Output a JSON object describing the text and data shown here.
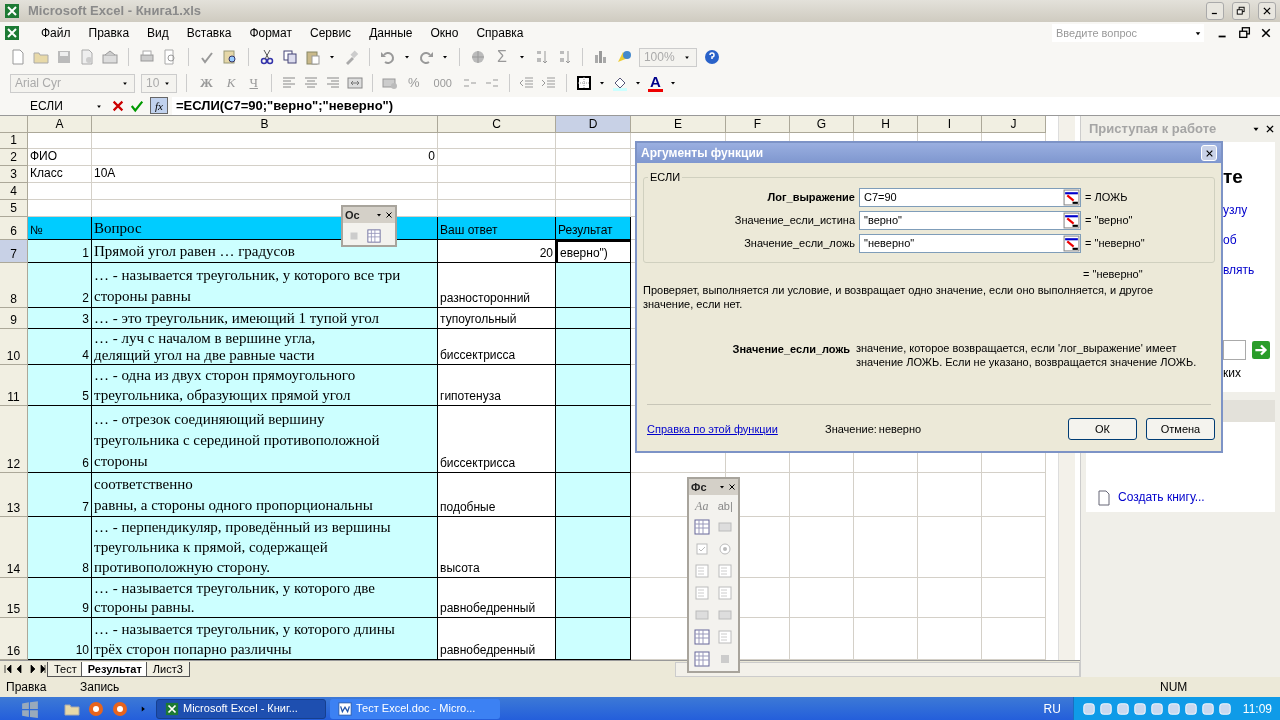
{
  "window": {
    "title": "Microsoft Excel - Книга1.xls"
  },
  "menu": [
    "Файл",
    "Правка",
    "Вид",
    "Вставка",
    "Формат",
    "Сервис",
    "Данные",
    "Окно",
    "Справка"
  ],
  "help_search": {
    "placeholder": "Введите вопрос"
  },
  "standard_toolbar": {
    "autosum": "Σ",
    "zoom": "100%"
  },
  "formatting_toolbar": {
    "font": "Arial Cyr",
    "size": "10",
    "bold": "Ж",
    "italic": "К",
    "underline": "Ч",
    "percent": "%",
    "thousands": "000",
    "font_color": "A"
  },
  "formula_bar": {
    "name_box": "ЕСЛИ",
    "fx": "fx",
    "formula": "=ЕСЛИ(C7=90;\"верно\";\"неверно\")"
  },
  "columns": [
    {
      "label": "A",
      "selected": false
    },
    {
      "label": "B",
      "selected": false
    },
    {
      "label": "C",
      "selected": false
    },
    {
      "label": "D",
      "selected": true
    },
    {
      "label": "E",
      "selected": false
    },
    {
      "label": "F",
      "selected": false
    },
    {
      "label": "G",
      "selected": false
    },
    {
      "label": "H",
      "selected": false
    },
    {
      "label": "I",
      "selected": false
    },
    {
      "label": "J",
      "selected": false
    }
  ],
  "rows": [
    {
      "header": "1",
      "selected": false
    },
    {
      "header": "2",
      "selected": false,
      "cells": [
        {
          "text": "ФИО",
          "kind": "text"
        },
        {
          "text": "0",
          "kind": "number"
        }
      ]
    },
    {
      "header": "3",
      "selected": false,
      "cells": [
        {
          "text": "Класс",
          "kind": "text"
        },
        {
          "text": "10А",
          "kind": "text"
        }
      ]
    },
    {
      "header": "4",
      "selected": false
    },
    {
      "header": "5",
      "selected": false
    },
    {
      "header": "6",
      "selected": false,
      "kind": "header",
      "cells": [
        {
          "text": "№",
          "kind": "text"
        },
        {
          "text": "Вопрос",
          "kind": "text"
        },
        {
          "text": "Ваш ответ",
          "kind": "text"
        },
        {
          "text": "Результат",
          "kind": "text"
        }
      ]
    },
    {
      "header": "7",
      "selected": true,
      "kind": "question",
      "cells": [
        {
          "text": "1",
          "kind": "number"
        },
        {
          "text": "Прямой угол равен … градусов",
          "kind": "text"
        },
        {
          "text": "20",
          "kind": "number"
        },
        {
          "text": "еверно\")",
          "kind": "edit"
        }
      ]
    },
    {
      "header": "8",
      "selected": false,
      "kind": "question",
      "cells": [
        {
          "text": "2",
          "kind": "number"
        },
        {
          "text": "… - называется треугольник, у которого все три\nстороны равны",
          "kind": "text"
        },
        {
          "text": "разносторонний",
          "kind": "text"
        }
      ]
    },
    {
      "header": "9",
      "selected": false,
      "kind": "question",
      "cells": [
        {
          "text": "3",
          "kind": "number"
        },
        {
          "text": "… - это треугольник, имеющий 1 тупой угол",
          "kind": "text"
        },
        {
          "text": "тупоугольный",
          "kind": "text"
        }
      ]
    },
    {
      "header": "10",
      "selected": false,
      "kind": "question",
      "cells": [
        {
          "text": "4",
          "kind": "number"
        },
        {
          "text": "… - луч с началом в вершине угла,\nделящий угол на две равные части",
          "kind": "text"
        },
        {
          "text": "биссектрисса",
          "kind": "text"
        }
      ]
    },
    {
      "header": "11",
      "selected": false,
      "kind": "question",
      "cells": [
        {
          "text": "5",
          "kind": "number"
        },
        {
          "text": "… - одна из двух сторон прямоугольного\nтреугольника, образующих прямой угол",
          "kind": "text"
        },
        {
          "text": "гипотенуза",
          "kind": "text"
        }
      ]
    },
    {
      "header": "12",
      "selected": false,
      "kind": "question",
      "cells": [
        {
          "text": "6",
          "kind": "number"
        },
        {
          "text": "… - отрезок соединяющий вершину\nтреугольника с серединой противоположной\nстороны",
          "kind": "text"
        },
        {
          "text": "биссектрисса",
          "kind": "text"
        }
      ]
    },
    {
      "header": "13",
      "selected": false,
      "kind": "question",
      "cells": [
        {
          "text": "7",
          "kind": "number"
        },
        {
          "text": "соответственно\nравны, а стороны одного пропорциональны",
          "kind": "text"
        },
        {
          "text": "подобные",
          "kind": "text"
        }
      ]
    },
    {
      "header": "14",
      "selected": false,
      "kind": "question",
      "cells": [
        {
          "text": "8",
          "kind": "number"
        },
        {
          "text": "… - перпендикуляр, проведённый из вершины\nтреугольника к прямой, содержащей\nпротивоположную сторону.",
          "kind": "text"
        },
        {
          "text": "высота",
          "kind": "text"
        }
      ]
    },
    {
      "header": "15",
      "selected": false,
      "kind": "question",
      "cells": [
        {
          "text": "9",
          "kind": "number"
        },
        {
          "text": "… - называется треугольник, у которого две\nстороны равны.",
          "kind": "text"
        },
        {
          "text": "равнобедренный",
          "kind": "text"
        }
      ]
    },
    {
      "header": "16",
      "selected": false,
      "kind": "question",
      "cells": [
        {
          "text": "10",
          "kind": "number"
        },
        {
          "text": "… - называется треугольник, у которого длины\nтрёх сторон попарно различны",
          "kind": "text"
        },
        {
          "text": "равнобедренный",
          "kind": "text"
        }
      ]
    }
  ],
  "outline_toolbar": {
    "title": "Ос"
  },
  "forms_toolbar": {
    "title": "Фс",
    "label_tool": "Aa",
    "edit_tool": "ab|"
  },
  "sheet_tabs": [
    {
      "label": "Тест",
      "selected": false
    },
    {
      "label": "Результат",
      "selected": true
    },
    {
      "label": "Лист3",
      "selected": false
    }
  ],
  "status_bar": {
    "mode": "Правка",
    "macro": "Запись",
    "num": "NUM"
  },
  "task_pane": {
    "title": "Приступая к работе",
    "heading_fragment": "те",
    "link_fragments": [
      "узлу",
      "об",
      "влять"
    ],
    "text_fragment": "ких",
    "create_link": "Создать книгу..."
  },
  "dialog": {
    "title": "Аргументы функции",
    "function": "ЕСЛИ",
    "arguments": [
      {
        "label": "Лог_выражение",
        "value": "C7=90",
        "result": "= ЛОЖЬ",
        "required": true
      },
      {
        "label": "Значение_если_истина",
        "value": "\"верно\"",
        "result": "= \"верно\"",
        "required": false
      },
      {
        "label": "Значение_если_ложь",
        "value": "\"неверно\"",
        "result": "= \"неверно\"",
        "required": false
      }
    ],
    "result": "= \"неверно\"",
    "description": "Проверяет, выполняется ли условие, и возвращает одно значение, если оно выполняется, и другое значение, если нет.",
    "argument_help": {
      "label": "Значение_если_ложь",
      "text": "значение, которое возвращается, если 'лог_выражение' имеет значение ЛОЖЬ. Если не указано, возвращается значение ЛОЖЬ."
    },
    "help_link": "Справка по этой функции",
    "value_label": "Значение:",
    "value": "неверно",
    "buttons": [
      "ОК",
      "Отмена"
    ]
  },
  "taskbar": {
    "tasks": [
      {
        "label": "Microsoft Excel - Книг...",
        "selected": true
      },
      {
        "label": "Тест Excel.doc - Micro...",
        "selected": false
      }
    ],
    "language": "RU",
    "time": "11:09"
  }
}
